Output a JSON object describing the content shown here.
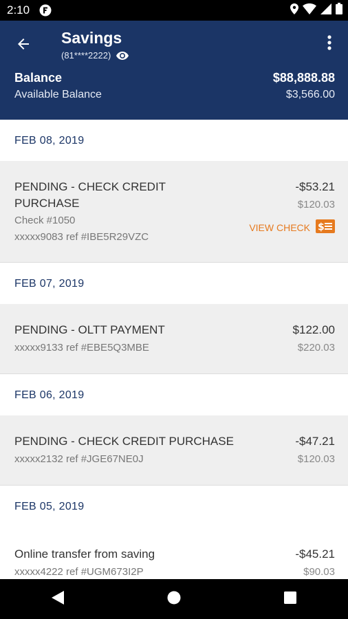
{
  "status_bar": {
    "time": "2:10"
  },
  "header": {
    "title": "Savings",
    "account_number": "(81****2222)",
    "balance_label": "Balance",
    "balance_value": "$88,888.88",
    "available_label": "Available Balance",
    "available_value": "$3,566.00"
  },
  "groups": [
    {
      "date": "FEB 08, 2019",
      "transactions": [
        {
          "description": "PENDING - CHECK CREDIT PURCHASE",
          "check_number": "Check #1050",
          "reference": "xxxxx9083 ref #IBE5R29VZC",
          "amount": "-$53.21",
          "running_balance": "$120.03",
          "view_check_label": "VIEW CHECK"
        }
      ]
    },
    {
      "date": "FEB 07, 2019",
      "transactions": [
        {
          "description": "PENDING - OLTT PAYMENT",
          "reference": "xxxxx9133 ref #EBE5Q3MBE",
          "amount": "$122.00",
          "running_balance": "$220.03"
        }
      ]
    },
    {
      "date": "FEB 06, 2019",
      "transactions": [
        {
          "description": "PENDING - CHECK CREDIT PURCHASE",
          "reference": "xxxxx2132 ref #JGE67NE0J",
          "amount": "-$47.21",
          "running_balance": "$120.03"
        }
      ]
    },
    {
      "date": "FEB 05, 2019",
      "transactions": [
        {
          "description": "Online transfer from saving",
          "reference": "xxxxx4222 ref #UGM673I2P",
          "amount": "-$45.21",
          "running_balance": "$90.03"
        }
      ]
    }
  ],
  "colors": {
    "header_bg": "#1b3566",
    "date_text": "#1b3566",
    "accent_orange": "#e67a1f",
    "row_bg": "#efefef"
  },
  "icons": {
    "back": "arrow-left-icon",
    "visibility": "eye-icon",
    "overflow": "more-vert-icon",
    "check_image": "check-image-icon",
    "nav_back": "triangle-back-icon",
    "nav_home": "circle-home-icon",
    "nav_recents": "square-recents-icon"
  }
}
